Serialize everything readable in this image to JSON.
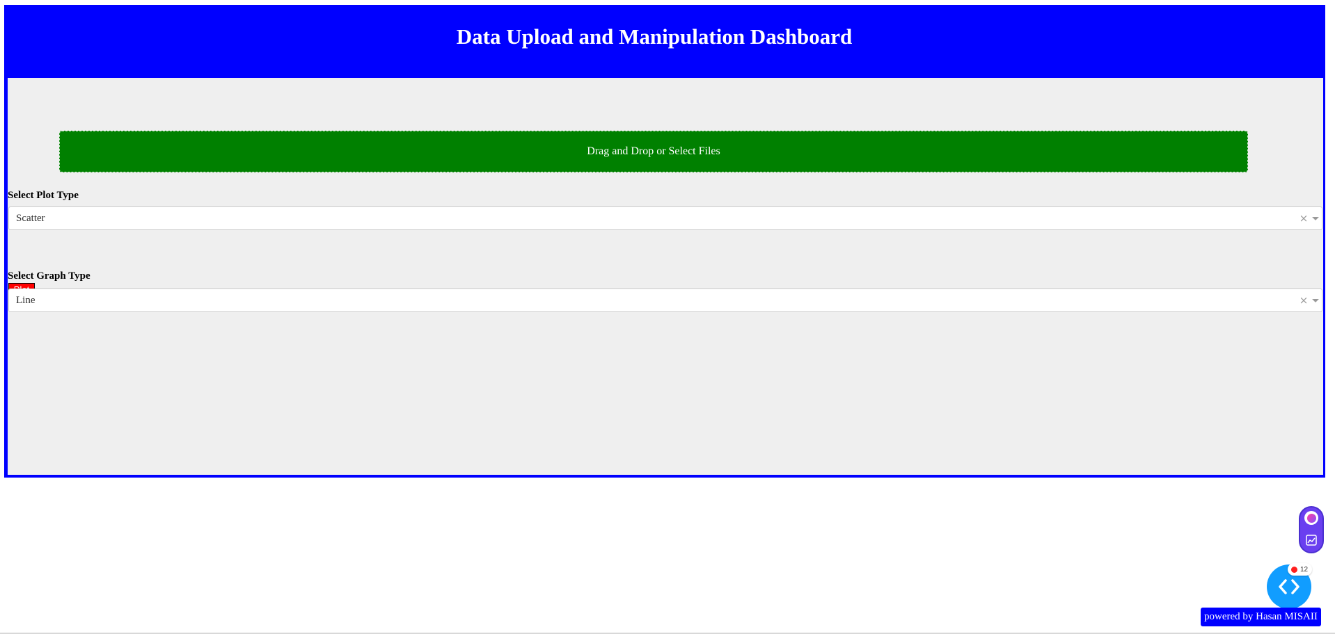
{
  "header": {
    "title": "Data Upload and Manipulation Dashboard"
  },
  "upload": {
    "label": "Drag and Drop or Select Files"
  },
  "plot_type": {
    "label": "Select Plot Type",
    "selected": "Scatter",
    "clear": "×"
  },
  "plot_button": {
    "label": "Plot"
  },
  "graph_type": {
    "label": "Select Graph Type",
    "selected": "Line",
    "clear": "×"
  },
  "dev_tools": {
    "badge_count": "12"
  },
  "footer": {
    "powered_by": "powered by Hasan MISAII"
  },
  "colors": {
    "frame": "#0000ff",
    "upload": "#008000",
    "plot_button": "#ff0000",
    "dev_button": "#119dff"
  },
  "icons": {
    "side_top": "ai-orb-icon",
    "side_bottom": "chart-icon",
    "dev": "code-chevrons-icon",
    "dropdown": "chevron-down-icon"
  }
}
